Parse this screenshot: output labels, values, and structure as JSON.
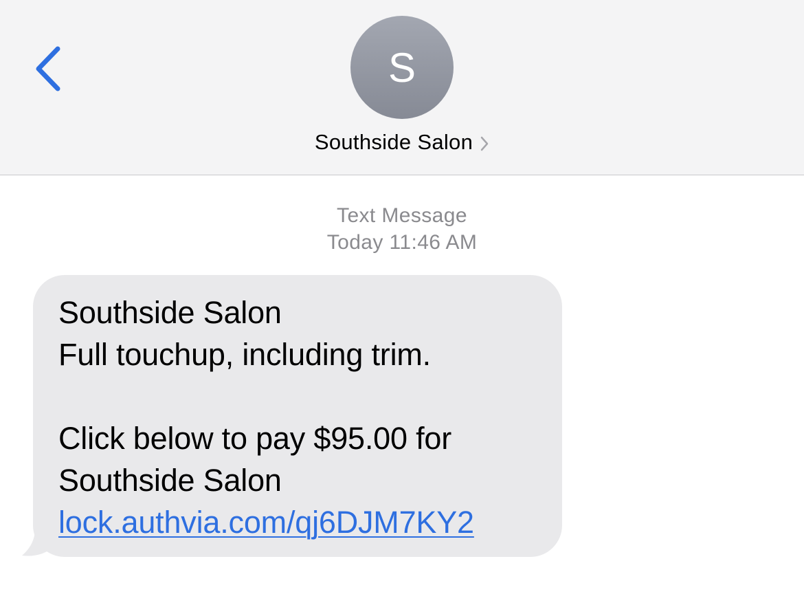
{
  "header": {
    "avatar_initial": "S",
    "contact_name": "Southside Salon"
  },
  "message_meta": {
    "type": "Text Message",
    "time": "Today 11:46 AM"
  },
  "message": {
    "line1": "Southside Salon",
    "line2": "Full touchup, including trim.",
    "line3": "Click below to pay $95.00 for",
    "line4": "Southside Salon",
    "link": "lock.authvia.com/qj6DJM7KY2"
  },
  "colors": {
    "accent": "#2e6fe0",
    "bubble": "#e9e9eb",
    "header_bg": "#f4f4f5",
    "meta_text": "#8a8a8e"
  },
  "icons": {
    "back": "chevron-left-icon",
    "contact_disclosure": "chevron-right-icon"
  }
}
